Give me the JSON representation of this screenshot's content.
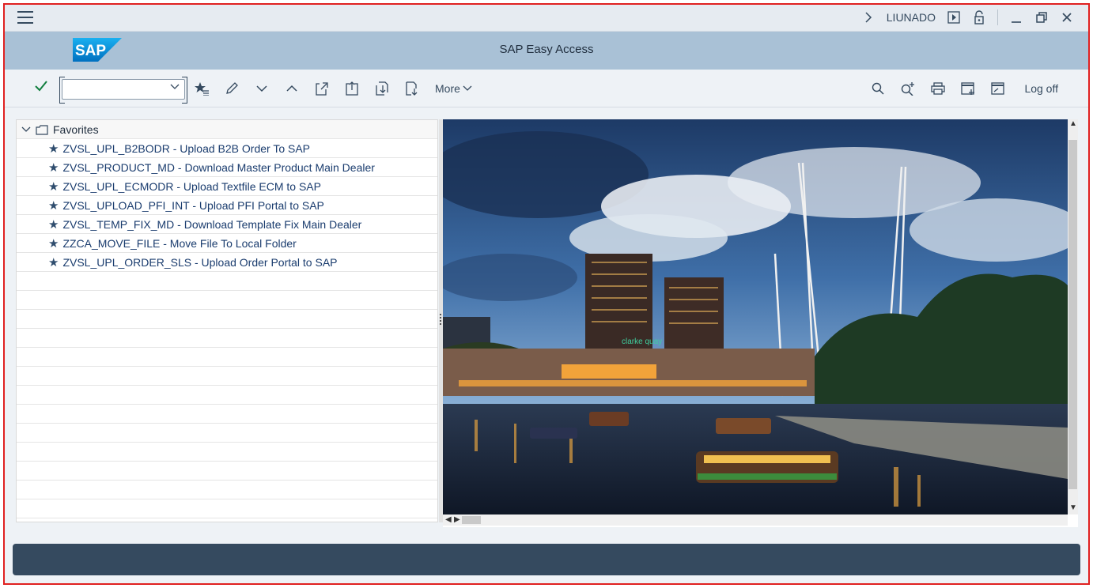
{
  "system_bar": {
    "user": "LIUNADO",
    "icons": [
      "menu-icon",
      "chevron-right-icon",
      "play-icon",
      "lock-icon",
      "minimize-icon",
      "restore-icon",
      "close-icon"
    ]
  },
  "title_bar": {
    "logo_text": "SAP",
    "title": "SAP Easy Access"
  },
  "toolbar": {
    "command_field_value": "",
    "more_label": "More",
    "logoff_label": "Log off",
    "icons_left": [
      "check-icon",
      "add-favorite-icon",
      "edit-icon",
      "move-down-icon",
      "move-up-icon",
      "upload-icon",
      "export-icon",
      "import-icon",
      "download-icon"
    ],
    "icons_right": [
      "search-icon",
      "search-next-icon",
      "print-icon",
      "new-session-icon",
      "shortcut-icon"
    ]
  },
  "tree": {
    "root_label": "Favorites",
    "items": [
      {
        "label": "ZVSL_UPL_B2BODR - Upload B2B Order To SAP"
      },
      {
        "label": "ZVSL_PRODUCT_MD - Download Master Product Main Dealer"
      },
      {
        "label": "ZVSL_UPL_ECMODR - Upload Textfile ECM to SAP"
      },
      {
        "label": "ZVSL_UPLOAD_PFI_INT - Upload PFI Portal to SAP"
      },
      {
        "label": "ZVSL_TEMP_FIX_MD - Download Template Fix Main Dealer"
      },
      {
        "label": "ZZCA_MOVE_FILE - Move File To Local Folder"
      },
      {
        "label": "ZVSL_UPL_ORDER_SLS - Upload Order Portal to SAP"
      }
    ]
  },
  "image": {
    "sign_text": "clarke quay"
  }
}
